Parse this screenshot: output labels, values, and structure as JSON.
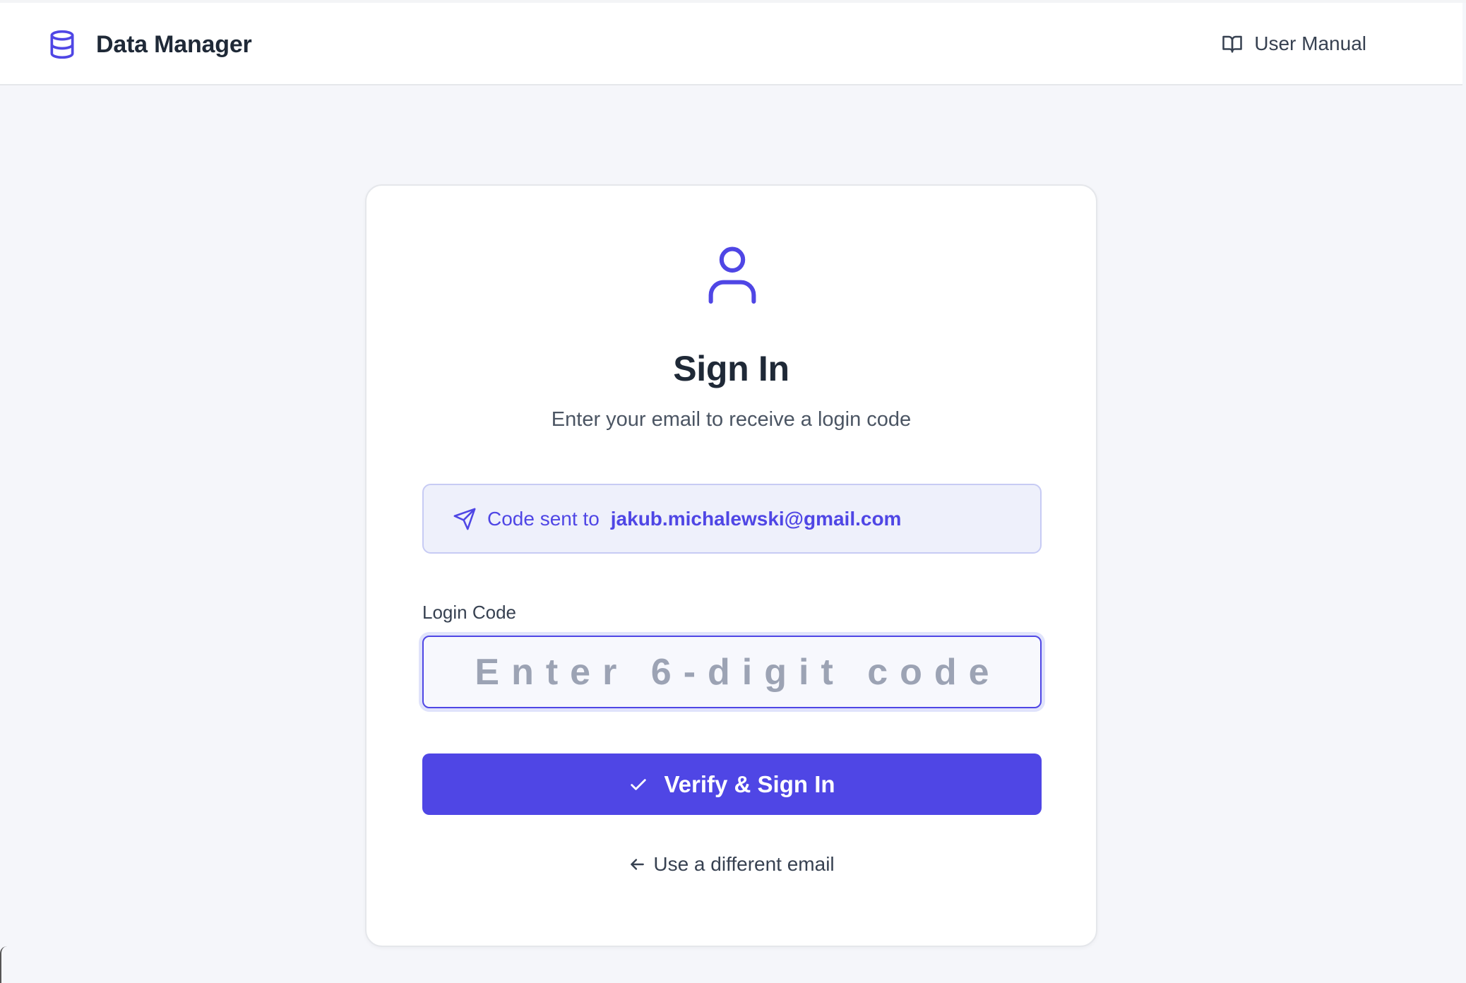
{
  "header": {
    "app_title": "Data Manager",
    "manual_label": "User Manual",
    "brand_icon": "database-icon",
    "manual_icon": "book-open-icon"
  },
  "card": {
    "icon": "user-icon",
    "title": "Sign In",
    "subtitle": "Enter your email to receive a login code",
    "notice": {
      "icon": "send-icon",
      "label": "Code sent to",
      "email": "jakub.michalewski@gmail.com"
    },
    "code_field": {
      "label": "Login Code",
      "placeholder": "Enter 6-digit code",
      "value": ""
    },
    "verify_button": {
      "icon": "check-icon",
      "label": "Verify & Sign In"
    },
    "back_link": {
      "icon": "arrow-left-icon",
      "label": "Use a different email"
    }
  },
  "colors": {
    "accent": "#4f46e5",
    "notice_bg": "#eef0fb",
    "page_bg": "#f5f6fa"
  }
}
